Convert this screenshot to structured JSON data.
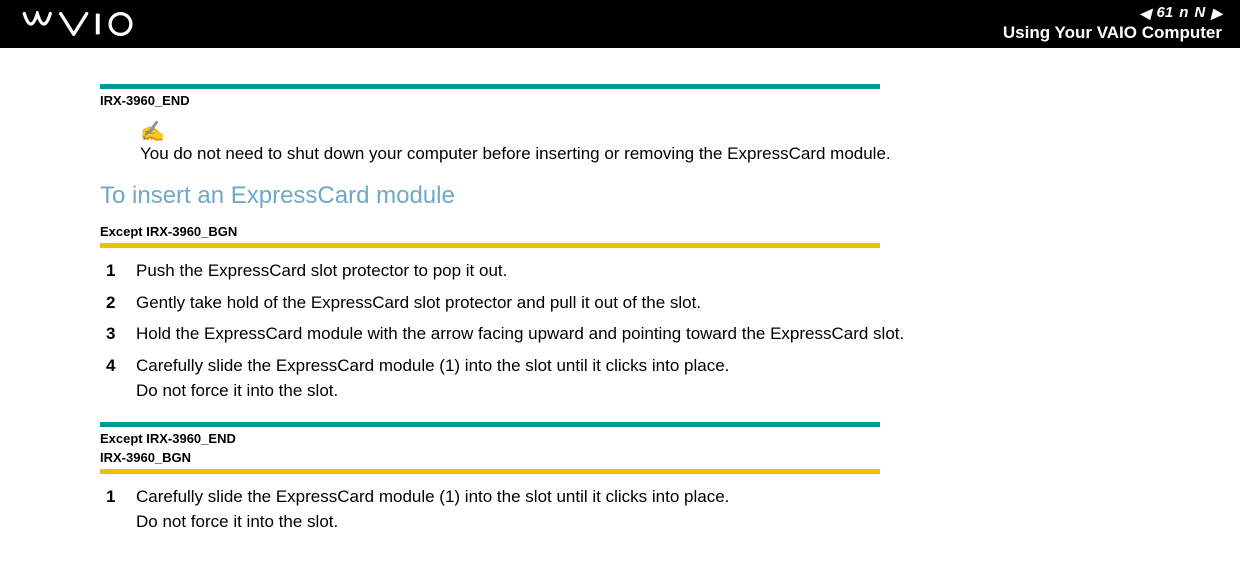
{
  "header": {
    "page_number": "61",
    "n_label": "n",
    "N_label": "N",
    "title": "Using Your VAIO Computer"
  },
  "tag1": {
    "label": "IRX-3960_END"
  },
  "note": {
    "icon": "✍",
    "text": "You do not need to shut down your computer before inserting or removing the ExpressCard module."
  },
  "heading": "To insert an ExpressCard module",
  "tag2": {
    "label": "Except IRX-3960_BGN"
  },
  "steps_a": [
    {
      "num": "1",
      "text": "Push the ExpressCard slot protector to pop it out."
    },
    {
      "num": "2",
      "text": "Gently take hold of the ExpressCard slot protector and pull it out of the slot."
    },
    {
      "num": "3",
      "text": "Hold the ExpressCard module with the arrow facing upward and pointing toward the ExpressCard slot."
    },
    {
      "num": "4",
      "text": "Carefully slide the ExpressCard module (1) into the slot until it clicks into place.\nDo not force it into the slot."
    }
  ],
  "tag3": {
    "label_a": "Except IRX-3960_END",
    "label_b": "IRX-3960_BGN"
  },
  "steps_b": [
    {
      "num": "1",
      "text": "Carefully slide the ExpressCard module (1) into the slot until it clicks into place.\nDo not force it into the slot."
    }
  ]
}
